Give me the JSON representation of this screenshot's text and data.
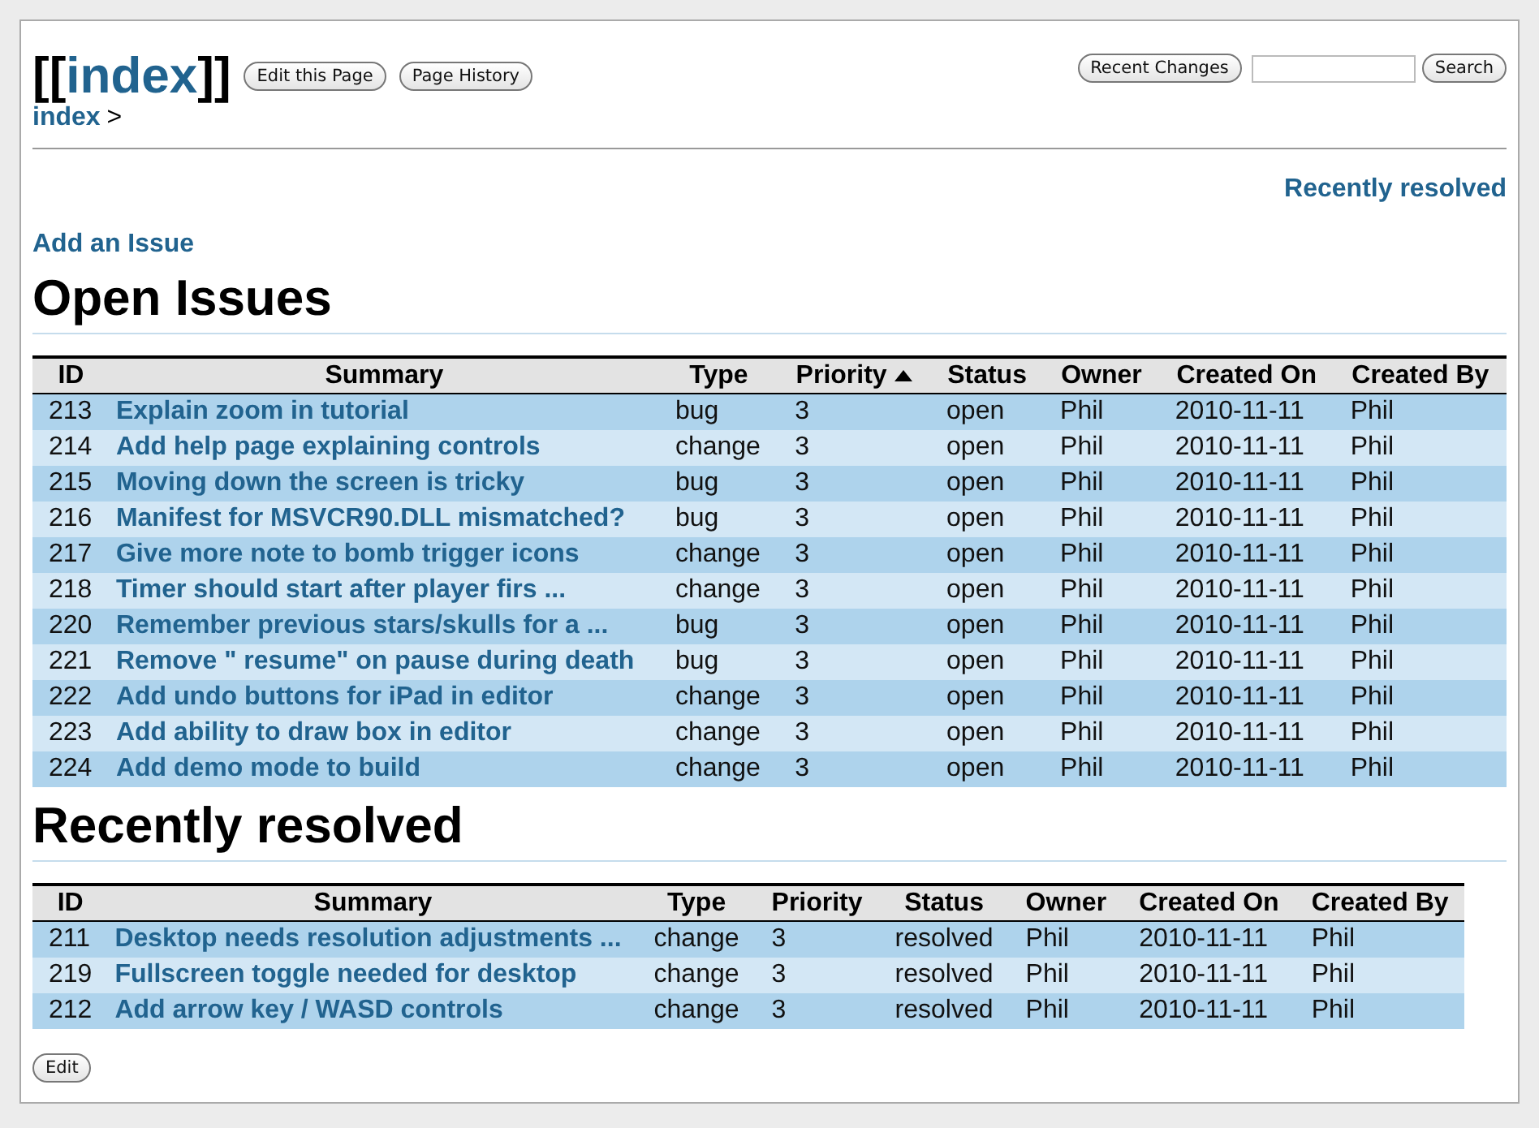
{
  "header": {
    "title": {
      "open": "[[",
      "link": "index",
      "close": "]]"
    },
    "page_buttons": [
      "Edit this Page",
      "Page History"
    ],
    "recent_button": "Recent Changes",
    "search": {
      "button": "Search"
    },
    "breadcrumb": {
      "link": "index",
      "separator": ">"
    }
  },
  "toc_link": "Recently resolved",
  "add_link": "Add an Issue",
  "sections": [
    {
      "heading": "Open Issues",
      "full_width": true,
      "columns": [
        {
          "label": "ID",
          "sorted": false
        },
        {
          "label": "Summary",
          "sorted": false
        },
        {
          "label": "Type",
          "sorted": false
        },
        {
          "label": "Priority",
          "sorted": true
        },
        {
          "label": "Status",
          "sorted": false
        },
        {
          "label": "Owner",
          "sorted": false
        },
        {
          "label": "Created On",
          "sorted": false
        },
        {
          "label": "Created By",
          "sorted": false
        }
      ],
      "rows": [
        {
          "id": "213",
          "summary": "Explain zoom in tutorial",
          "type": "bug",
          "priority": "3",
          "status": "open",
          "owner": "Phil",
          "created_on": "2010-11-11",
          "created_by": "Phil"
        },
        {
          "id": "214",
          "summary": "Add help page explaining controls",
          "type": "change",
          "priority": "3",
          "status": "open",
          "owner": "Phil",
          "created_on": "2010-11-11",
          "created_by": "Phil"
        },
        {
          "id": "215",
          "summary": "Moving down the screen is tricky",
          "type": "bug",
          "priority": "3",
          "status": "open",
          "owner": "Phil",
          "created_on": "2010-11-11",
          "created_by": "Phil"
        },
        {
          "id": "216",
          "summary": "Manifest for MSVCR90.DLL mismatched?",
          "type": "bug",
          "priority": "3",
          "status": "open",
          "owner": "Phil",
          "created_on": "2010-11-11",
          "created_by": "Phil"
        },
        {
          "id": "217",
          "summary": "Give more note to bomb trigger icons",
          "type": "change",
          "priority": "3",
          "status": "open",
          "owner": "Phil",
          "created_on": "2010-11-11",
          "created_by": "Phil"
        },
        {
          "id": "218",
          "summary": "Timer should start after player firs ...",
          "type": "change",
          "priority": "3",
          "status": "open",
          "owner": "Phil",
          "created_on": "2010-11-11",
          "created_by": "Phil"
        },
        {
          "id": "220",
          "summary": "Remember previous stars/skulls for a ...",
          "type": "bug",
          "priority": "3",
          "status": "open",
          "owner": "Phil",
          "created_on": "2010-11-11",
          "created_by": "Phil"
        },
        {
          "id": "221",
          "summary": "Remove \" resume\"  on pause during death",
          "type": "bug",
          "priority": "3",
          "status": "open",
          "owner": "Phil",
          "created_on": "2010-11-11",
          "created_by": "Phil"
        },
        {
          "id": "222",
          "summary": "Add undo buttons for iPad in editor",
          "type": "change",
          "priority": "3",
          "status": "open",
          "owner": "Phil",
          "created_on": "2010-11-11",
          "created_by": "Phil"
        },
        {
          "id": "223",
          "summary": "Add ability to draw box in editor",
          "type": "change",
          "priority": "3",
          "status": "open",
          "owner": "Phil",
          "created_on": "2010-11-11",
          "created_by": "Phil"
        },
        {
          "id": "224",
          "summary": "Add demo mode to build",
          "type": "change",
          "priority": "3",
          "status": "open",
          "owner": "Phil",
          "created_on": "2010-11-11",
          "created_by": "Phil"
        }
      ]
    },
    {
      "heading": "Recently resolved",
      "full_width": false,
      "columns": [
        {
          "label": "ID",
          "sorted": false
        },
        {
          "label": "Summary",
          "sorted": false
        },
        {
          "label": "Type",
          "sorted": false
        },
        {
          "label": "Priority",
          "sorted": false
        },
        {
          "label": "Status",
          "sorted": false
        },
        {
          "label": "Owner",
          "sorted": false
        },
        {
          "label": "Created On",
          "sorted": false
        },
        {
          "label": "Created By",
          "sorted": false
        }
      ],
      "rows": [
        {
          "id": "211",
          "summary": "Desktop needs resolution adjustments ...",
          "type": "change",
          "priority": "3",
          "status": "resolved",
          "owner": "Phil",
          "created_on": "2010-11-11",
          "created_by": "Phil"
        },
        {
          "id": "219",
          "summary": "Fullscreen toggle needed for desktop",
          "type": "change",
          "priority": "3",
          "status": "resolved",
          "owner": "Phil",
          "created_on": "2010-11-11",
          "created_by": "Phil"
        },
        {
          "id": "212",
          "summary": "Add arrow key / WASD controls",
          "type": "change",
          "priority": "3",
          "status": "resolved",
          "owner": "Phil",
          "created_on": "2010-11-11",
          "created_by": "Phil"
        }
      ]
    }
  ],
  "footer_button": "Edit"
}
